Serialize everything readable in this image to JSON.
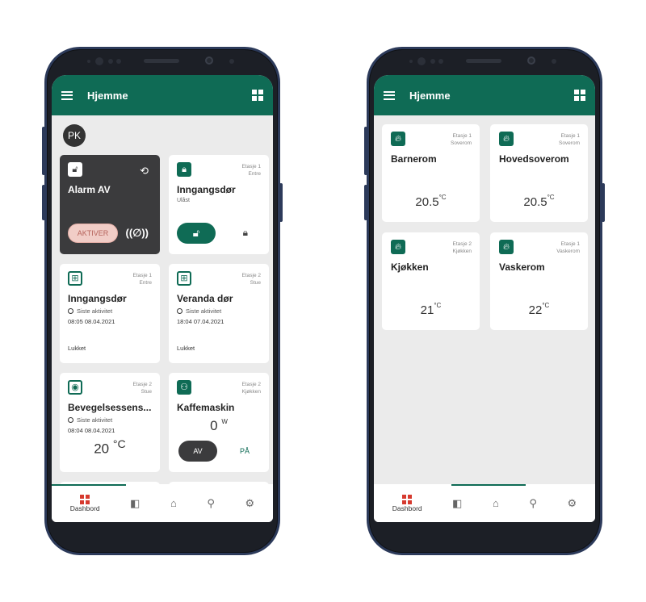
{
  "left": {
    "appbar": {
      "title": "Hjemme"
    },
    "avatar": {
      "initials": "PK"
    },
    "alarm": {
      "title": "Alarm AV",
      "button": "AKTIVER"
    },
    "door_lock": {
      "meta_floor": "Etasje 1",
      "meta_room": "Entre",
      "title": "Inngangsdør",
      "status": "Ulåst"
    },
    "sensors": [
      {
        "meta_floor": "Etasje 1",
        "meta_room": "Entre",
        "title": "Inngangsdør",
        "activity": "Siste aktivitet",
        "time": "08:05",
        "date": "08.04.2021",
        "state": "Lukket"
      },
      {
        "meta_floor": "Etasje 2",
        "meta_room": "Stue",
        "title": "Veranda dør",
        "activity": "Siste aktivitet",
        "time": "18:04",
        "date": "07.04.2021",
        "state": "Lukket"
      }
    ],
    "motion": {
      "meta_floor": "Etasje 2",
      "meta_room": "Stue",
      "title": "Bevegelsessens...",
      "activity": "Siste aktivitet",
      "time": "08:04",
      "date": "08.04.2021",
      "value": "20",
      "unit": "°C"
    },
    "coffee": {
      "meta_floor": "Etasje 2",
      "meta_room": "Kjøkken",
      "title": "Kaffemaskin",
      "value": "0",
      "unit": "W",
      "off_label": "AV",
      "on_label": "PÅ"
    },
    "nav": {
      "dashboard_label": "Dashbord"
    }
  },
  "right": {
    "appbar": {
      "title": "Hjemme"
    },
    "rooms": [
      {
        "meta_floor": "Etasje 1",
        "meta_room": "Soverom",
        "title": "Barnerom",
        "value": "20.5",
        "unit": "°C"
      },
      {
        "meta_floor": "Etasje 1",
        "meta_room": "Soverom",
        "title": "Hovedsoverom",
        "value": "20.5",
        "unit": "°C"
      },
      {
        "meta_floor": "Etasje 2",
        "meta_room": "Kjøkken",
        "title": "Kjøkken",
        "value": "21",
        "unit": "°C"
      },
      {
        "meta_floor": "Etasje 1",
        "meta_room": "Vaskerom",
        "title": "Vaskerom",
        "value": "22",
        "unit": "°C"
      }
    ],
    "nav": {
      "dashboard_label": "Dashbord"
    }
  },
  "icons": {
    "menu": "hamburger-menu-icon",
    "grid_add": "grid-add-icon",
    "unlocked": "unlocked-padlock-icon",
    "history": "history-icon",
    "siren": "siren-icon",
    "door_sensor": "door-sensor-icon",
    "motion": "motion-sensor-icon",
    "plug": "smart-plug-icon",
    "flame": "thermostat-flame-icon",
    "dashboard": "dashboard-icon",
    "floorplan": "floorplan-icon",
    "home": "home-icon",
    "location": "location-icon",
    "settings": "settings-icon"
  },
  "colors": {
    "primary": "#0f6b55",
    "dark_card": "#3b3b3d",
    "accent_red": "#d63a2f",
    "alarm_button": "#f1cdc7",
    "background": "#ebebeb"
  }
}
